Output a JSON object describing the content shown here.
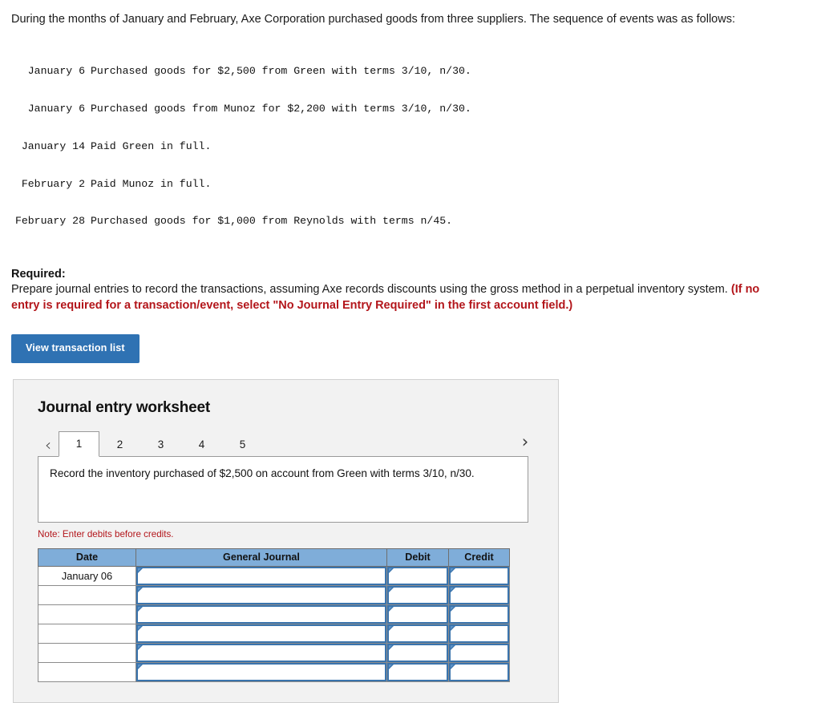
{
  "intro": {
    "paragraph": "During the months of January and February, Axe Corporation purchased goods from three suppliers. The sequence of events was as follows:"
  },
  "transactions": [
    {
      "date": "January 6",
      "description": "Purchased goods for $2,500 from Green with terms 3/10, n/30."
    },
    {
      "date": "January 6",
      "description": "Purchased goods from Munoz for $2,200 with terms 3/10, n/30."
    },
    {
      "date": "January 14",
      "description": "Paid Green in full."
    },
    {
      "date": "February 2",
      "description": "Paid Munoz in full."
    },
    {
      "date": "February 28",
      "description": "Purchased goods for $1,000 from Reynolds with terms n/45."
    }
  ],
  "required": {
    "heading": "Required:",
    "body": "Prepare journal entries to record the transactions, assuming Axe records discounts using the gross method in a perpetual inventory system. ",
    "emphasis": "(If no entry is required for a transaction/event, select \"No Journal Entry Required\" in the first account field.)"
  },
  "toolbar": {
    "view_transaction_list_label": "View transaction list"
  },
  "worksheet": {
    "title": "Journal entry worksheet",
    "prev_arrow": "‹",
    "next_arrow": "›",
    "tabs": [
      {
        "label": "1",
        "active": true
      },
      {
        "label": "2",
        "active": false
      },
      {
        "label": "3",
        "active": false
      },
      {
        "label": "4",
        "active": false
      },
      {
        "label": "5",
        "active": false
      }
    ],
    "instruction": "Record the inventory purchased of $2,500 on account from Green with terms 3/10, n/30.",
    "note": "Note: Enter debits before credits.",
    "table": {
      "headers": [
        "Date",
        "General Journal",
        "Debit",
        "Credit"
      ],
      "rows": [
        {
          "date": "January 06",
          "general_journal": "",
          "debit": "",
          "credit": ""
        },
        {
          "date": "",
          "general_journal": "",
          "debit": "",
          "credit": ""
        },
        {
          "date": "",
          "general_journal": "",
          "debit": "",
          "credit": ""
        },
        {
          "date": "",
          "general_journal": "",
          "debit": "",
          "credit": ""
        },
        {
          "date": "",
          "general_journal": "",
          "debit": "",
          "credit": ""
        },
        {
          "date": "",
          "general_journal": "",
          "debit": "",
          "credit": ""
        }
      ]
    }
  },
  "colors": {
    "button_blue": "#2f72b3",
    "header_blue": "#7fadd9",
    "alert_red": "#b3161b",
    "panel_gray": "#f2f2f2",
    "input_border_blue": "#3a74ad"
  }
}
